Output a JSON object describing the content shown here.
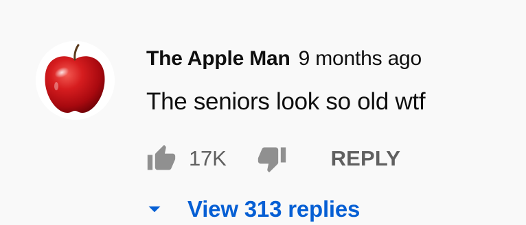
{
  "comment": {
    "avatar_icon": "apple-avatar-icon",
    "author": "The Apple Man",
    "timestamp": "9 months ago",
    "text": "The seniors look so old wtf",
    "actions": {
      "like_icon": "thumbs-up-icon",
      "like_count": "17K",
      "dislike_icon": "thumbs-down-icon",
      "reply_label": "REPLY"
    },
    "replies": {
      "toggle_icon": "caret-down-icon",
      "label": "View 313 replies"
    }
  },
  "colors": {
    "background": "#f9f9f9",
    "text_primary": "#0f0f0f",
    "text_secondary": "#606060",
    "link_blue": "#065fd4",
    "icon_gray": "#909090"
  }
}
